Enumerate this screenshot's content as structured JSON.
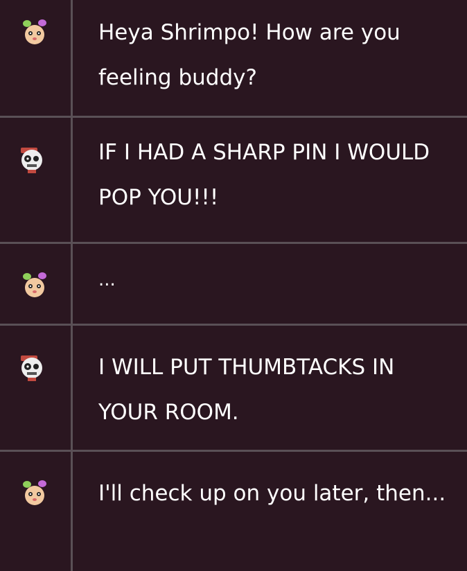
{
  "messages": [
    {
      "speaker": "pink-bunny-avatar",
      "text": "Heya Shrimpo! How are you feeling buddy?"
    },
    {
      "speaker": "skull-mask-avatar",
      "text": "IF I HAD A SHARP PIN I WOULD POP YOU!!!"
    },
    {
      "speaker": "pink-bunny-avatar",
      "text": "..."
    },
    {
      "speaker": "skull-mask-avatar",
      "text": "I WILL PUT THUMBTACKS IN YOUR ROOM."
    },
    {
      "speaker": "pink-bunny-avatar",
      "text": "I'll check up on you later, then..."
    }
  ],
  "colors": {
    "background": "#2a1620",
    "divider": "#5a5056",
    "text": "#ffffff"
  }
}
